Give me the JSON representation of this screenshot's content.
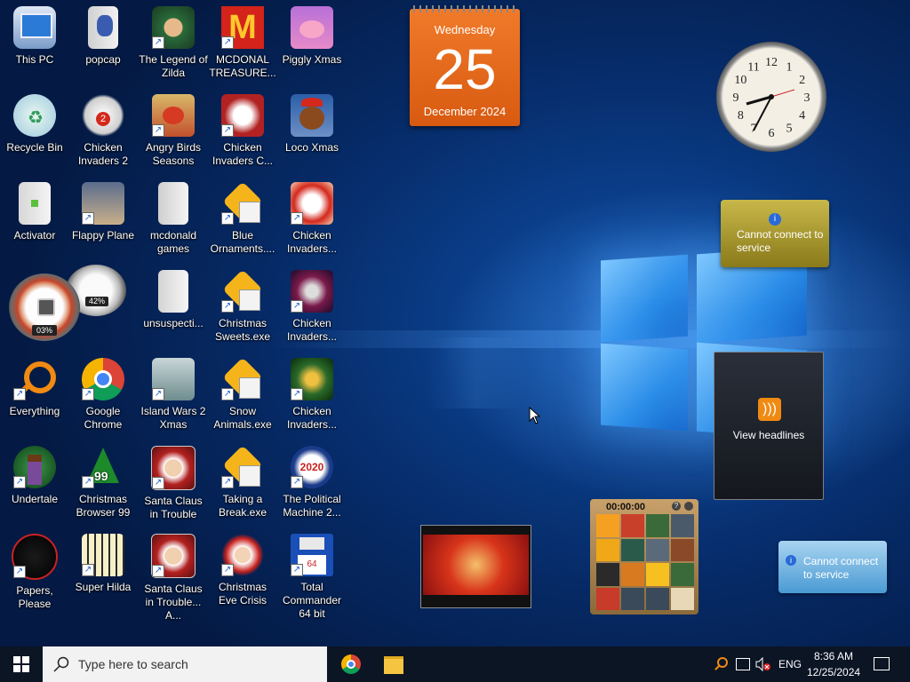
{
  "desktop": {
    "icons": [
      {
        "label": "This PC"
      },
      {
        "label": "popcap"
      },
      {
        "label": "The Legend of Zilda"
      },
      {
        "label": "MCDONAL TREASURE..."
      },
      {
        "label": "Piggly Xmas"
      },
      {
        "label": "Recycle Bin"
      },
      {
        "label": "Chicken Invaders 2"
      },
      {
        "label": "Angry Birds Seasons"
      },
      {
        "label": "Chicken Invaders C..."
      },
      {
        "label": "Loco Xmas"
      },
      {
        "label": "Activator"
      },
      {
        "label": "Flappy Plane"
      },
      {
        "label": "mcdonald games"
      },
      {
        "label": "Blue Ornaments...."
      },
      {
        "label": "Chicken Invaders..."
      },
      {
        "label": "unsuspecti..."
      },
      {
        "label": "Christmas Sweets.exe"
      },
      {
        "label": "Chicken Invaders..."
      },
      {
        "label": "Everything"
      },
      {
        "label": "Google Chrome"
      },
      {
        "label": "Island Wars 2 Xmas"
      },
      {
        "label": "Snow Animals.exe"
      },
      {
        "label": "Chicken Invaders..."
      },
      {
        "label": "Undertale"
      },
      {
        "label": "Christmas Browser 99"
      },
      {
        "label": "Santa Claus in Trouble"
      },
      {
        "label": "Taking a Break.exe"
      },
      {
        "label": "The Political Machine 2..."
      },
      {
        "label": "Papers, Please"
      },
      {
        "label": "Super Hilda"
      },
      {
        "label": "Santa Claus in Trouble... A..."
      },
      {
        "label": "Christmas Eve Crisis"
      },
      {
        "label": "Total Commander 64 bit"
      }
    ]
  },
  "gadgets": {
    "calendar": {
      "weekday": "Wednesday",
      "day": "25",
      "month_year": "December 2024"
    },
    "clock": {
      "numbers": [
        "12",
        "1",
        "2",
        "3",
        "4",
        "5",
        "6",
        "7",
        "8",
        "9",
        "10",
        "11"
      ]
    },
    "cpu_meter": {
      "cpu": "03%",
      "memory": "42%"
    },
    "currency": {
      "message": "Cannot connect to service"
    },
    "weather": {
      "message": "Cannot connect to service"
    },
    "feeds": {
      "label": "View headlines"
    },
    "puzzle": {
      "timer": "00:00:00"
    }
  },
  "taskbar": {
    "search_placeholder": "Type here to search",
    "language": "ENG",
    "time": "8:36 AM",
    "date": "12/25/2024"
  },
  "colors": {
    "calendar_orange": "#e8661a",
    "taskbar": "#0c1524",
    "desktop_blue": "#0e4fa8"
  }
}
